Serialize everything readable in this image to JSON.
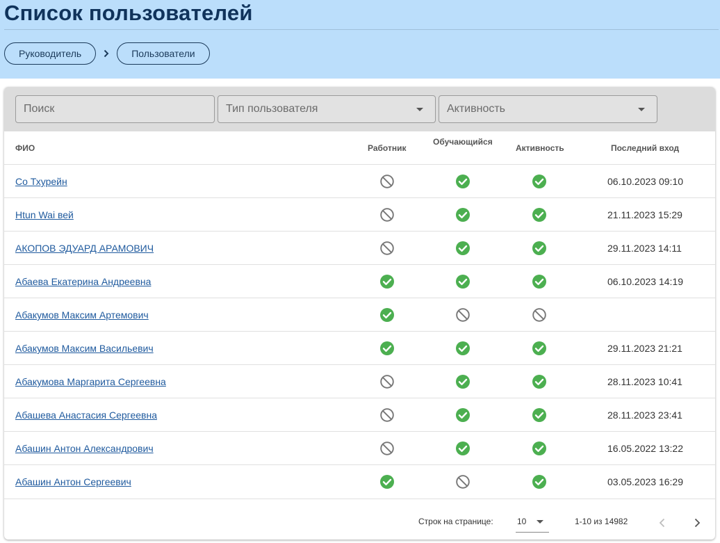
{
  "page": {
    "title": "Список пользователей"
  },
  "breadcrumb": [
    {
      "label": "Руководитель"
    },
    {
      "label": "Пользователи"
    }
  ],
  "filters": {
    "search_placeholder": "Поиск",
    "user_type_placeholder": "Тип пользователя",
    "activity_placeholder": "Активность"
  },
  "table": {
    "columns": {
      "fio": "ФИО",
      "worker": "Работник",
      "learner": "Обучающийся",
      "active": "Активность",
      "last_login": "Последний вход"
    },
    "rows": [
      {
        "name": "Со Тхурейн",
        "worker": false,
        "learner": true,
        "active": true,
        "last_login": "06.10.2023 09:10"
      },
      {
        "name": "Htun Wai вей",
        "worker": false,
        "learner": true,
        "active": true,
        "last_login": "21.11.2023 15:29"
      },
      {
        "name": "АКОПОВ ЭДУАРД АРАМОВИЧ",
        "worker": false,
        "learner": true,
        "active": true,
        "last_login": "29.11.2023 14:11"
      },
      {
        "name": "Абаева Екатерина Андреевна",
        "worker": true,
        "learner": true,
        "active": true,
        "last_login": "06.10.2023 14:19"
      },
      {
        "name": "Абакумов Максим Артемович",
        "worker": true,
        "learner": false,
        "active": false,
        "last_login": ""
      },
      {
        "name": "Абакумов Максим Васильевич",
        "worker": true,
        "learner": true,
        "active": true,
        "last_login": "29.11.2023 21:21"
      },
      {
        "name": "Абакумова Маргарита Сергеевна",
        "worker": false,
        "learner": true,
        "active": true,
        "last_login": "28.11.2023 10:41"
      },
      {
        "name": "Абашева Анастасия Сергеевна",
        "worker": false,
        "learner": true,
        "active": true,
        "last_login": "28.11.2023 23:41"
      },
      {
        "name": "Абашин Антон Александрович",
        "worker": false,
        "learner": true,
        "active": true,
        "last_login": "16.05.2022 13:22"
      },
      {
        "name": "Абашин Антон Сергеевич",
        "worker": true,
        "learner": false,
        "active": true,
        "last_login": "03.05.2023 16:29"
      }
    ]
  },
  "pagination": {
    "rows_per_page_label": "Строк на странице:",
    "rows_per_page_value": "10",
    "range_text": "1-10 из 14982"
  },
  "colors": {
    "header_bg": "#bbdefb",
    "title": "#10335b",
    "link": "#1f5a9e",
    "check": "#4caf50",
    "blocked": "#777777"
  },
  "icons": {
    "true": "check-circle-icon",
    "false": "block-icon"
  }
}
